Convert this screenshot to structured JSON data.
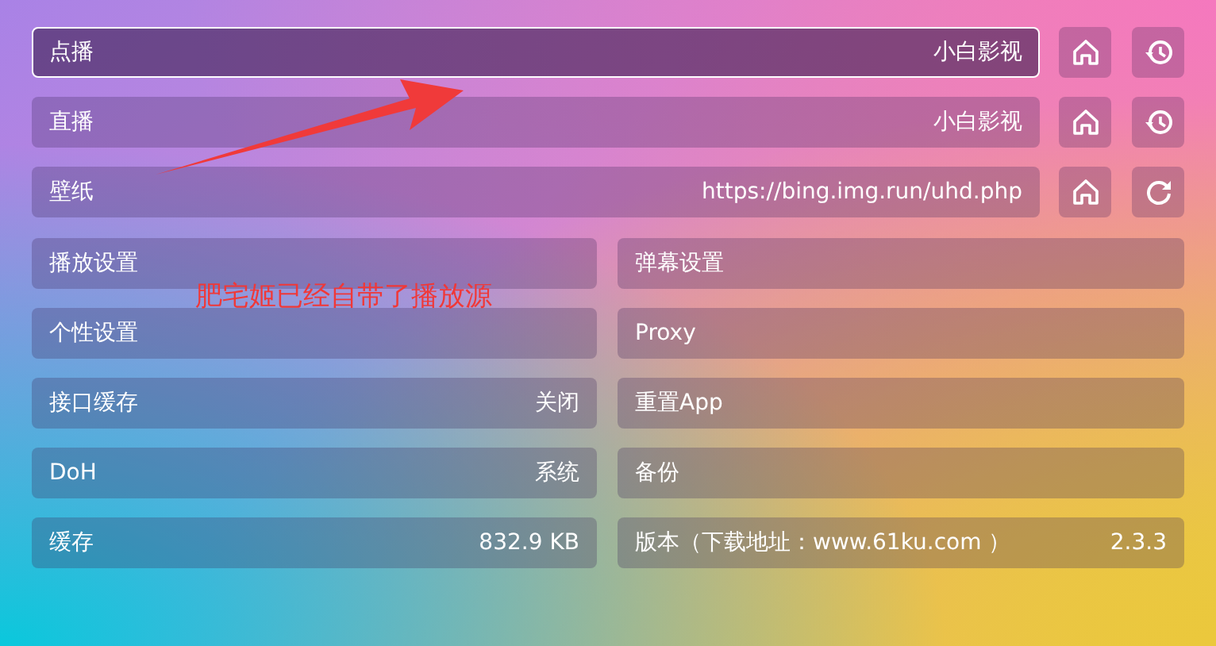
{
  "sources": [
    {
      "label": "点播",
      "value": "小白影视",
      "selected": true,
      "buttons": [
        {
          "kind": "home"
        },
        {
          "kind": "history"
        }
      ]
    },
    {
      "label": "直播",
      "value": "小白影视",
      "selected": false,
      "buttons": [
        {
          "kind": "home"
        },
        {
          "kind": "history"
        }
      ]
    },
    {
      "label": "壁纸",
      "value": "https://bing.img.run/uhd.php",
      "selected": false,
      "buttons": [
        {
          "kind": "home"
        },
        {
          "kind": "refresh"
        }
      ]
    }
  ],
  "settings": [
    {
      "label": "播放设置"
    },
    {
      "label": "弹幕设置"
    },
    {
      "label": "个性设置"
    },
    {
      "label": "Proxy"
    },
    {
      "label": "接口缓存",
      "value": "关闭"
    },
    {
      "label": "重置App"
    },
    {
      "label": "DoH",
      "value": "系统"
    },
    {
      "label": "备份"
    },
    {
      "label": "缓存",
      "value": "832.9 KB"
    },
    {
      "label": "版本（下载地址：www.61ku.com ）",
      "value": "2.3.3"
    }
  ],
  "annotation": {
    "text": "肥宅姬已经自带了播放源"
  }
}
